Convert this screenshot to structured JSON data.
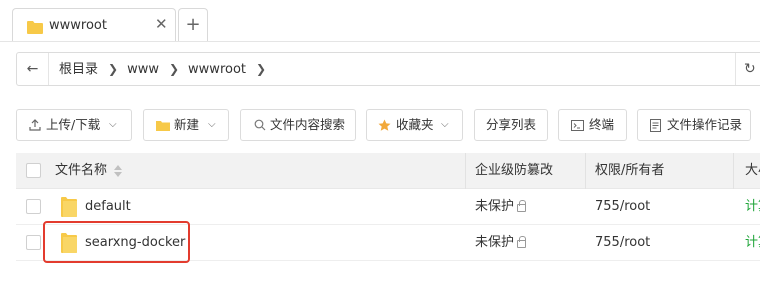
{
  "tabs": {
    "active_label": "wwwroot",
    "close_glyph": "✕",
    "add_glyph": "+"
  },
  "path": {
    "back_glyph": "←",
    "crumbs": [
      "根目录",
      "www",
      "wwwroot"
    ],
    "separator": "❯",
    "refresh_glyph": "↻"
  },
  "toolbar": {
    "upload_label": "上传/下载",
    "new_label": "新建",
    "search_label": "文件内容搜索",
    "favorites_label": "收藏夹",
    "share_label": "分享列表",
    "terminal_label": "终端",
    "log_label": "文件操作记录",
    "chevron": "⌵"
  },
  "table": {
    "headers": {
      "name": "文件名称",
      "protect": "企业级防篡改",
      "perm": "权限/所有者",
      "size": "大小"
    },
    "rows": [
      {
        "name": "default",
        "protect": "未保护",
        "perm": "755/root",
        "size": "计算"
      },
      {
        "name": "searxng-docker",
        "protect": "未保护",
        "perm": "755/root",
        "size": "计算"
      }
    ]
  },
  "colors": {
    "accent_green": "#20a53a",
    "highlight_red": "#e33b2e",
    "folder_yellow": "#f7c948"
  },
  "icons": [
    "folder-icon",
    "back-arrow-icon",
    "refresh-icon",
    "upload-icon",
    "new-folder-icon",
    "search-icon",
    "star-icon",
    "terminal-icon",
    "log-icon",
    "lock-icon",
    "sort-icon"
  ]
}
